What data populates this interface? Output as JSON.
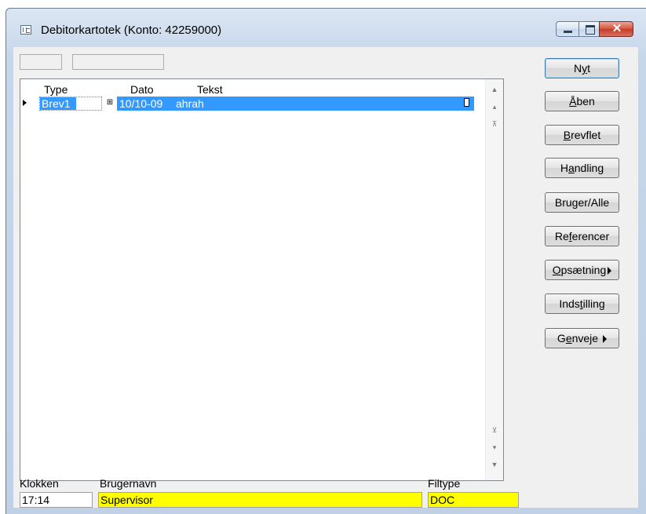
{
  "window": {
    "title": "Debitorkartotek (Konto: 42259000)",
    "controls": {
      "close_glyph": "✕"
    }
  },
  "grid": {
    "columns": [
      "Type",
      "Dato",
      "Tekst"
    ],
    "rows": [
      {
        "type": "Brev1",
        "dato": "10/10-09",
        "tekst": "ahrah"
      }
    ]
  },
  "buttons": [
    {
      "pre": "N",
      "key": "y",
      "post": "t"
    },
    {
      "pre": "",
      "key": "Å",
      "post": "ben"
    },
    {
      "pre": "",
      "key": "B",
      "post": "revflet"
    },
    {
      "pre": "H",
      "key": "a",
      "post": "ndling"
    },
    {
      "pre": "Bru",
      "key": "g",
      "post": "er/Alle"
    },
    {
      "pre": "Re",
      "key": "f",
      "post": "erencer"
    },
    {
      "pre": "",
      "key": "O",
      "post": "psætning"
    },
    {
      "pre": "Inds",
      "key": "t",
      "post": "illing"
    },
    {
      "pre": "G",
      "key": "e",
      "post": "nveje"
    }
  ],
  "status": {
    "clock_label": "Klokken",
    "clock_value": "17:14",
    "user_label": "Brugernavn",
    "user_value": "Supervisor",
    "filetype_label": "Filtype",
    "filetype_value": "DOC"
  },
  "colors": {
    "selection": "#3399ff",
    "highlight_field": "#ffff00"
  },
  "icons": {
    "title": "window-list-icon",
    "dropdown": "dropdown-arrow-icon",
    "memo": "memo-icon"
  }
}
